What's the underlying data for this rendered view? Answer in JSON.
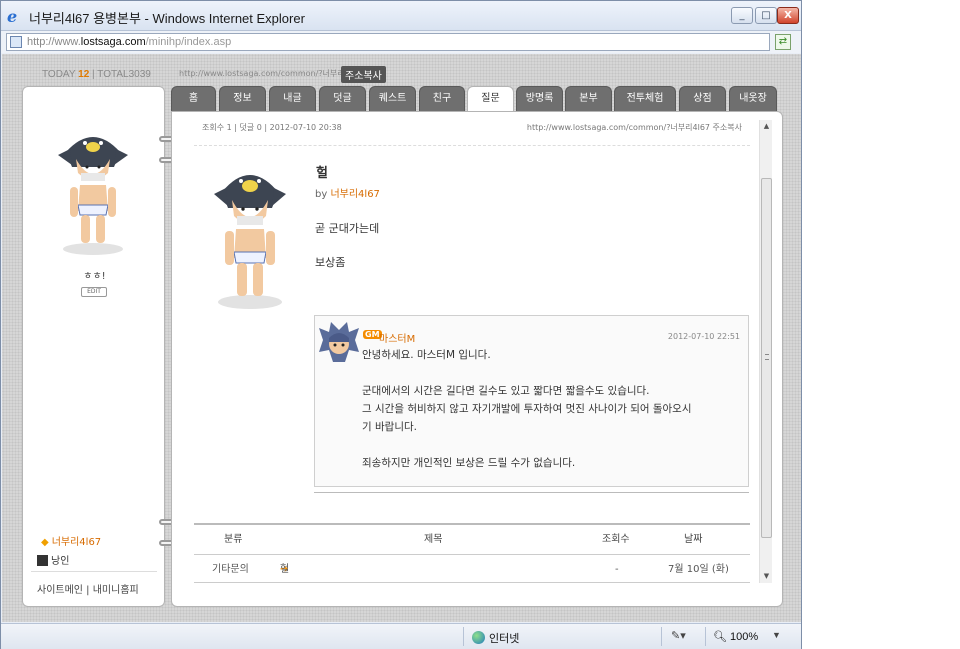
{
  "window": {
    "title": "너부리4l67 용병본부 - Windows Internet Explorer",
    "minimize": "_",
    "maximize": "□",
    "close": "X"
  },
  "address": {
    "url_prefix": "http://www.",
    "url_host": "lostsaga.com",
    "url_path": "/minihp/index.asp"
  },
  "counter": {
    "today_label": "TODAY",
    "today_value": "12",
    "sep": "|",
    "total_label": "TOTAL",
    "total_value": "3039"
  },
  "homepage": {
    "url": "http://www.lostsaga.com/common/?너부리4l67",
    "copy_label": "주소복사"
  },
  "profile": {
    "status": "ㅎㅎ!",
    "edit_label": "EDIT",
    "username": "너부리4l67",
    "rank": "낭인",
    "links": "사이트메인 | 내미니홈피"
  },
  "tabs": [
    {
      "label": "홈"
    },
    {
      "label": "정보"
    },
    {
      "label": "내글"
    },
    {
      "label": "덧글"
    },
    {
      "label": "퀘스트"
    },
    {
      "label": "친구"
    },
    {
      "label": "질문"
    },
    {
      "label": "방명록"
    },
    {
      "label": "본부"
    },
    {
      "label": "전투체험"
    },
    {
      "label": "상점"
    },
    {
      "label": "내옷장"
    }
  ],
  "meta_strip": {
    "left": "조회수 1 | 덧글 0 | 2012-07-10 20:38",
    "right": "http://www.lostsaga.com/common/?너부리4l67 주소복사"
  },
  "post": {
    "title": "헐",
    "by_label": "by",
    "author": "너부리4l67",
    "body": [
      "곧 군대가는데",
      "보상좀"
    ]
  },
  "reply": {
    "badge": "GM",
    "name": "마스터M",
    "date": "2012-07-10 22:51",
    "greeting": "안녕하세요. 마스터M 입니다.",
    "para1_l1": "군대에서의 시간은 길다면 길수도 있고 짧다면 짧을수도 있습니다.",
    "para1_l2": "그 시간을 허비하지 않고 자기개발에 투자하여 멋진 사나이가 되어 돌아오시",
    "para1_l3": "기 바랍니다.",
    "para2": "죄송하지만 개인적인 보상은 드릴 수가 없습니다."
  },
  "list": {
    "headers": {
      "category": "분류",
      "title": "제목",
      "views": "조회수",
      "date": "날짜"
    },
    "rows": [
      {
        "category": "기타문의",
        "title": "헐",
        "views": "-",
        "date": "7월 10일 (화)"
      }
    ]
  },
  "statusbar": {
    "zone": "인터넷",
    "zoom": "100%"
  },
  "colors": {
    "accent_orange": "#d76b00",
    "tab_gray": "#6f6f6f",
    "ie_blue": "#2a6fd1"
  }
}
